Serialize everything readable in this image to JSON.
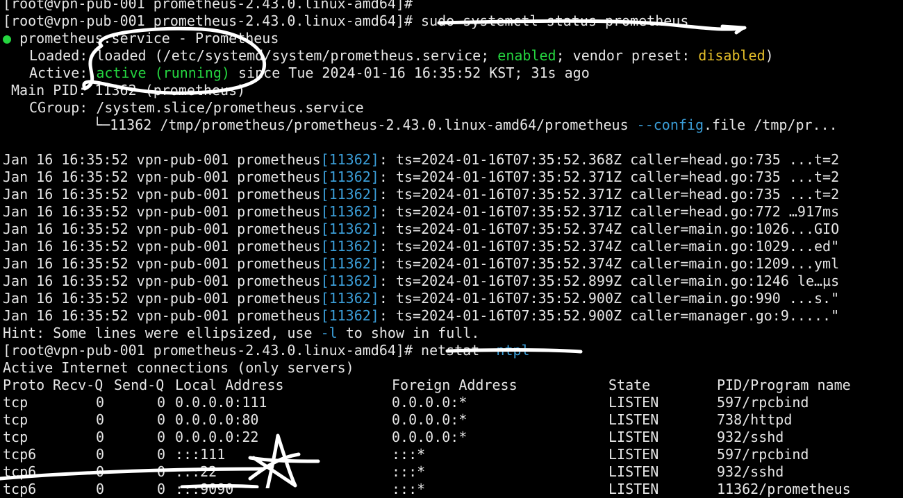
{
  "terminal": {
    "prompt_line1": "[root@vpn-pub-001 prometheus-2.43.0.linux-amd64]#",
    "prompt_cut": "[root@vpn-pub-001 prometheus-2.43.0.linux-amd64]#",
    "cmd1": " sudo systemctl status prometheus",
    "service": {
      "bullet": "●",
      "title": " prometheus.service - Prometheus",
      "loaded_label": "Loaded: ",
      "loaded_value": "loaded (/etc/systemd/system/prometheus.service; ",
      "enabled": "enabled",
      "vendor": "; vendor preset: ",
      "disabled": "disabled",
      "close": ")",
      "active_label": "Active: ",
      "active_state": "active (running)",
      "active_since": " since Tue 2024-01-16 16:35:52 KST; 31s ago",
      "mainpid": "Main PID: 11362 (prometheus)",
      "cgroup": "CGroup: /system.slice/prometheus.service",
      "cgroup_tree": "└─11362 /tmp/prometheus/prometheus-2.43.0.linux-amd64/prometheus ",
      "cgroup_flag": "--config",
      "cgroup_rest": ".file /tmp/pr..."
    },
    "log_prefix": "Jan 16 16:35:52 vpn-pub-001 prometheus",
    "log_pid": "[11362]",
    "logs": [
      ": ts=2024-01-16T07:35:52.368Z caller=head.go:735 ...t=2",
      ": ts=2024-01-16T07:35:52.371Z caller=head.go:735 ...t=2",
      ": ts=2024-01-16T07:35:52.371Z caller=head.go:735 ...t=2",
      ": ts=2024-01-16T07:35:52.371Z caller=head.go:772 …917ms",
      ": ts=2024-01-16T07:35:52.374Z caller=main.go:1026...GIO",
      ": ts=2024-01-16T07:35:52.374Z caller=main.go:1029...ed\"",
      ": ts=2024-01-16T07:35:52.374Z caller=main.go:1209...yml",
      ": ts=2024-01-16T07:35:52.899Z caller=main.go:1246 le…µs",
      ": ts=2024-01-16T07:35:52.900Z caller=main.go:990 ...s.\"",
      ": ts=2024-01-16T07:35:52.900Z caller=manager.go:9.....\""
    ],
    "hint_pre": "Hint: Some lines were ellipsized, use ",
    "hint_flag": "-l",
    "hint_post": " to show in full.",
    "prompt2": "[root@vpn-pub-001 prometheus-2.43.0.linux-amd64]#",
    "cmd2_a": " netstat ",
    "cmd2_flag": "-ntpl",
    "netstat_title": "Active Internet connections (only servers)",
    "headers": [
      "Proto",
      "Recv-Q",
      "Send-Q",
      "Local Address",
      "Foreign Address",
      "State",
      "PID/Program name"
    ],
    "rows": [
      [
        "tcp",
        "0",
        "0",
        "0.0.0.0:111",
        "0.0.0.0:*",
        "LISTEN",
        "597/rpcbind"
      ],
      [
        "tcp",
        "0",
        "0",
        "0.0.0.0:80",
        "0.0.0.0:*",
        "LISTEN",
        "738/httpd"
      ],
      [
        "tcp",
        "0",
        "0",
        "0.0.0.0:22",
        "0.0.0.0:*",
        "LISTEN",
        "932/sshd"
      ],
      [
        "tcp6",
        "0",
        "0",
        ":::111",
        ":::*",
        "LISTEN",
        "597/rpcbind"
      ],
      [
        "tcp6",
        "0",
        "0",
        ":::22",
        ":::*",
        "LISTEN",
        "932/sshd"
      ],
      [
        "tcp6",
        "0",
        "0",
        ":::9090",
        ":::*",
        "LISTEN",
        "11362/prometheus"
      ]
    ],
    "colors": {
      "green": "#25d640",
      "yellow": "#e6c02a",
      "blue": "#3b9ed8",
      "text": "#e6e6e6",
      "background": "#000000"
    }
  }
}
